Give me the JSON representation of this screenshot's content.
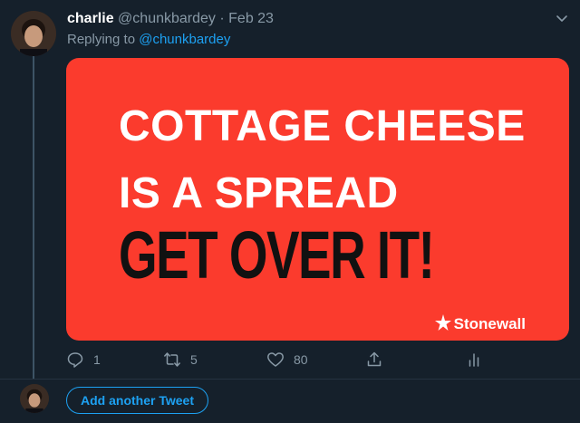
{
  "tweet": {
    "display_name": "charlie",
    "handle": "@chunkbardey",
    "separator": "·",
    "date": "Feb 23",
    "replying_prefix": "Replying to",
    "replying_handle": "@chunkbardey",
    "media": {
      "line1": "COTTAGE CHEESE",
      "line2": "IS A SPREAD",
      "line3": "GET OVER IT!",
      "brand": "Stonewall",
      "background_color": "#fb3b2d"
    },
    "actions": {
      "reply_count": "1",
      "retweet_count": "5",
      "like_count": "80"
    }
  },
  "composer": {
    "add_another_label": "Add another Tweet"
  },
  "colors": {
    "background": "#15202b",
    "accent": "#1da1f2",
    "muted": "#8899a6"
  }
}
